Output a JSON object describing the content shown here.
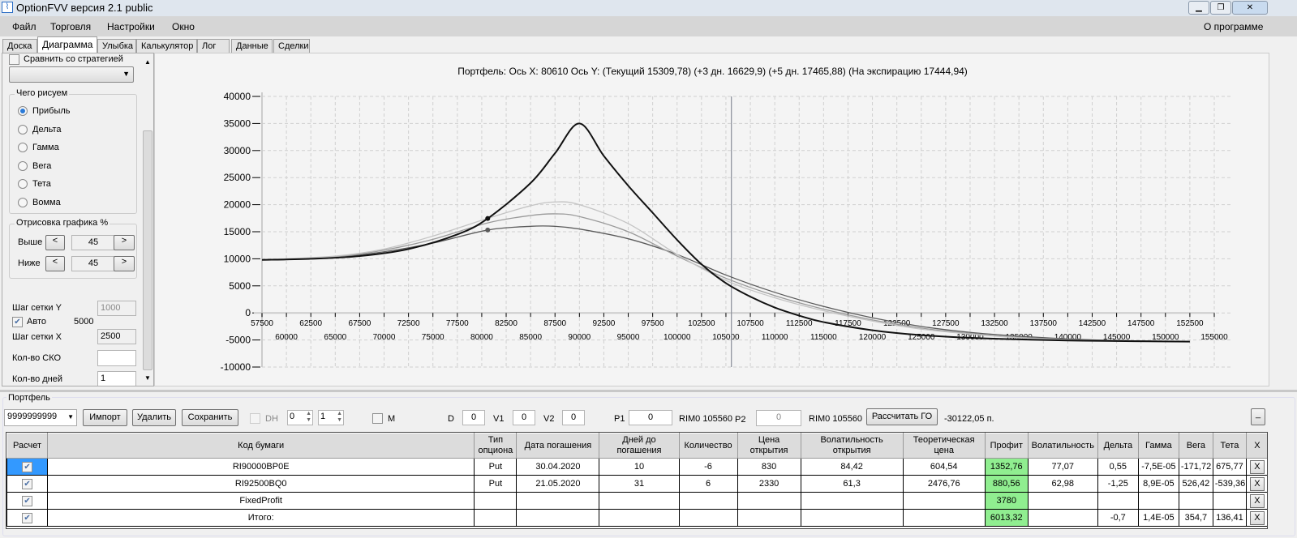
{
  "window": {
    "title": "OptionFVV версия 2.1 public",
    "icon": "chart-icon"
  },
  "menu": {
    "items": [
      "Файл",
      "Торговля",
      "Настройки",
      "Окно"
    ],
    "about": "О программе"
  },
  "tabs": [
    "Доска",
    "Диаграмма",
    "Улыбка",
    "Калькулятор",
    "Лог",
    "Данные",
    "Сделки"
  ],
  "active_tab": "Диаграмма",
  "left": {
    "compare_label": "Сравнить со стратегией",
    "draw_group": "Чего рисуем",
    "radios": [
      "Прибыль",
      "Дельта",
      "Гамма",
      "Вега",
      "Тета",
      "Вомма"
    ],
    "selected_radio": "Прибыль",
    "render_group": "Отрисовка графика %",
    "above_label": "Выше",
    "above_value": "45",
    "below_label": "Ниже",
    "below_value": "45",
    "prev": "<",
    "next": ">",
    "grid_y_label": "Шаг сетки Y",
    "grid_y_value": "1000",
    "auto_label": "Авто",
    "auto_value": "5000",
    "auto_checked": true,
    "grid_x_label": "Шаг сетки X",
    "grid_x_value": "2500",
    "sko_label": "Кол-во СКО",
    "sko_value": "",
    "days_label": "Кол-во дней",
    "days_value": "1"
  },
  "chart_data": {
    "type": "line",
    "title": "Портфель: Ось X: 80610 Ось Y:  (Текущий 15309,78)  (+3 дн. 16629,9)  (+5 дн. 17465,88)  (На экспирацию 17444,94)",
    "xlim": [
      57500,
      155000
    ],
    "ylim": [
      -10000,
      40000
    ],
    "yticks": [
      -10000,
      -5000,
      0,
      5000,
      10000,
      15000,
      20000,
      25000,
      30000,
      35000,
      40000
    ],
    "xticks_top": [
      57500,
      62500,
      67500,
      72500,
      77500,
      82500,
      87500,
      92500,
      97500,
      102500,
      107500,
      112500,
      117500,
      122500,
      127500,
      132500,
      137500,
      142500,
      147500,
      152500
    ],
    "xticks_bottom": [
      60000,
      65000,
      70000,
      75000,
      80000,
      85000,
      90000,
      95000,
      100000,
      105000,
      110000,
      115000,
      120000,
      125000,
      130000,
      135000,
      140000,
      145000,
      150000,
      155000
    ],
    "grid": true,
    "cursor_x": 80610,
    "underlying_x": 105560,
    "series": [
      {
        "color": "#5a5a5a",
        "points": [
          [
            57500,
            9800
          ],
          [
            65000,
            10300
          ],
          [
            70000,
            11300
          ],
          [
            75000,
            12900
          ],
          [
            80610,
            15310
          ],
          [
            85000,
            16000
          ],
          [
            87500,
            16000
          ],
          [
            90000,
            15500
          ],
          [
            95000,
            13700
          ],
          [
            100000,
            10800
          ],
          [
            105000,
            7000
          ],
          [
            110000,
            3800
          ],
          [
            115000,
            1200
          ],
          [
            120000,
            -900
          ],
          [
            125000,
            -2500
          ],
          [
            130000,
            -3600
          ],
          [
            135000,
            -4300
          ],
          [
            140000,
            -4800
          ],
          [
            145000,
            -5100
          ],
          [
            152500,
            -5300
          ]
        ],
        "marker": 15310
      },
      {
        "color": "#9a9a9a",
        "points": [
          [
            57500,
            9800
          ],
          [
            65000,
            10400
          ],
          [
            70000,
            11600
          ],
          [
            75000,
            13600
          ],
          [
            80610,
            16630
          ],
          [
            85000,
            18000
          ],
          [
            87500,
            18300
          ],
          [
            90000,
            17800
          ],
          [
            95000,
            15000
          ],
          [
            100000,
            10500
          ],
          [
            105000,
            6400
          ],
          [
            110000,
            3200
          ],
          [
            115000,
            700
          ],
          [
            120000,
            -1300
          ],
          [
            125000,
            -2800
          ],
          [
            130000,
            -3800
          ],
          [
            135000,
            -4500
          ],
          [
            140000,
            -4900
          ],
          [
            145000,
            -5200
          ],
          [
            152500,
            -5300
          ]
        ]
      },
      {
        "color": "#c4c4c4",
        "points": [
          [
            57500,
            9800
          ],
          [
            65000,
            10500
          ],
          [
            70000,
            11800
          ],
          [
            75000,
            14200
          ],
          [
            80610,
            17466
          ],
          [
            85000,
            19800
          ],
          [
            87500,
            20500
          ],
          [
            90000,
            20000
          ],
          [
            95000,
            16500
          ],
          [
            100000,
            10800
          ],
          [
            105000,
            6000
          ],
          [
            110000,
            2800
          ],
          [
            115000,
            400
          ],
          [
            120000,
            -1500
          ],
          [
            125000,
            -3000
          ],
          [
            130000,
            -3900
          ],
          [
            135000,
            -4600
          ],
          [
            140000,
            -5000
          ],
          [
            145000,
            -5200
          ],
          [
            152500,
            -5300
          ]
        ]
      },
      {
        "color": "#111111",
        "width": 2,
        "points": [
          [
            57500,
            9800
          ],
          [
            62500,
            10000
          ],
          [
            67500,
            10500
          ],
          [
            72500,
            11800
          ],
          [
            77500,
            14500
          ],
          [
            80610,
            17445
          ],
          [
            85000,
            24000
          ],
          [
            87500,
            29500
          ],
          [
            90000,
            35000
          ],
          [
            92500,
            29000
          ],
          [
            95000,
            23500
          ],
          [
            97500,
            18500
          ],
          [
            100000,
            13500
          ],
          [
            102500,
            9000
          ],
          [
            105000,
            5500
          ],
          [
            107500,
            3000
          ],
          [
            110000,
            1000
          ],
          [
            112500,
            -500
          ],
          [
            115000,
            -1700
          ],
          [
            120000,
            -3200
          ],
          [
            125000,
            -4100
          ],
          [
            130000,
            -4600
          ],
          [
            135000,
            -4900
          ],
          [
            140000,
            -5100
          ],
          [
            145000,
            -5200
          ],
          [
            152500,
            -5300
          ]
        ],
        "marker": 17445
      }
    ]
  },
  "portfolio": {
    "group": "Портфель",
    "account": "9999999999",
    "import": "Импорт",
    "delete": "Удалить",
    "save": "Сохранить",
    "dh": "DH",
    "spin1": "0",
    "spin2": "1",
    "m": "M",
    "d_label": "D",
    "d": "0",
    "v1_label": "V1",
    "v1": "0",
    "v2_label": "V2",
    "v2": "0",
    "p1_label": "P1",
    "p1": "0",
    "rim1": "RIM0 105560",
    "p2_label": "P2",
    "p2": "0",
    "rim2": "RIM0 105560",
    "calc_go": "Рассчитать ГО",
    "go_value": "-30122,05 п.",
    "minimize": "_"
  },
  "table": {
    "headers": [
      "Расчет",
      "Код бумаги",
      "Тип опциона",
      "Дата погашения",
      "Дней до погашения",
      "Количество",
      "Цена открытия",
      "Волатильность открытия",
      "Теоретическая цена",
      "Профит",
      "Волатильность",
      "Дельта",
      "Гамма",
      "Вега",
      "Тета",
      "X"
    ],
    "rows": [
      [
        "RI90000BP0E",
        "Put",
        "30.04.2020",
        "10",
        "-6",
        "830",
        "84,42",
        "604,54",
        "1352,76",
        "77,07",
        "0,55",
        "-7,5E-05",
        "-171,72",
        "675,77"
      ],
      [
        "RI92500BQ0",
        "Put",
        "21.05.2020",
        "31",
        "6",
        "2330",
        "61,3",
        "2476,76",
        "880,56",
        "62,98",
        "-1,25",
        "8,9E-05",
        "526,42",
        "-539,36"
      ],
      [
        "FixedProfit",
        "",
        "",
        "",
        "",
        "",
        "",
        "",
        "3780",
        "",
        "",
        "",
        "",
        ""
      ],
      [
        "Итого:",
        "",
        "",
        "",
        "",
        "",
        "",
        "",
        "6013,32",
        "",
        "-0,7",
        "1,4E-05",
        "354,7",
        "136,41"
      ]
    ],
    "delete_label": "X",
    "profit_color": "#90ee90"
  }
}
